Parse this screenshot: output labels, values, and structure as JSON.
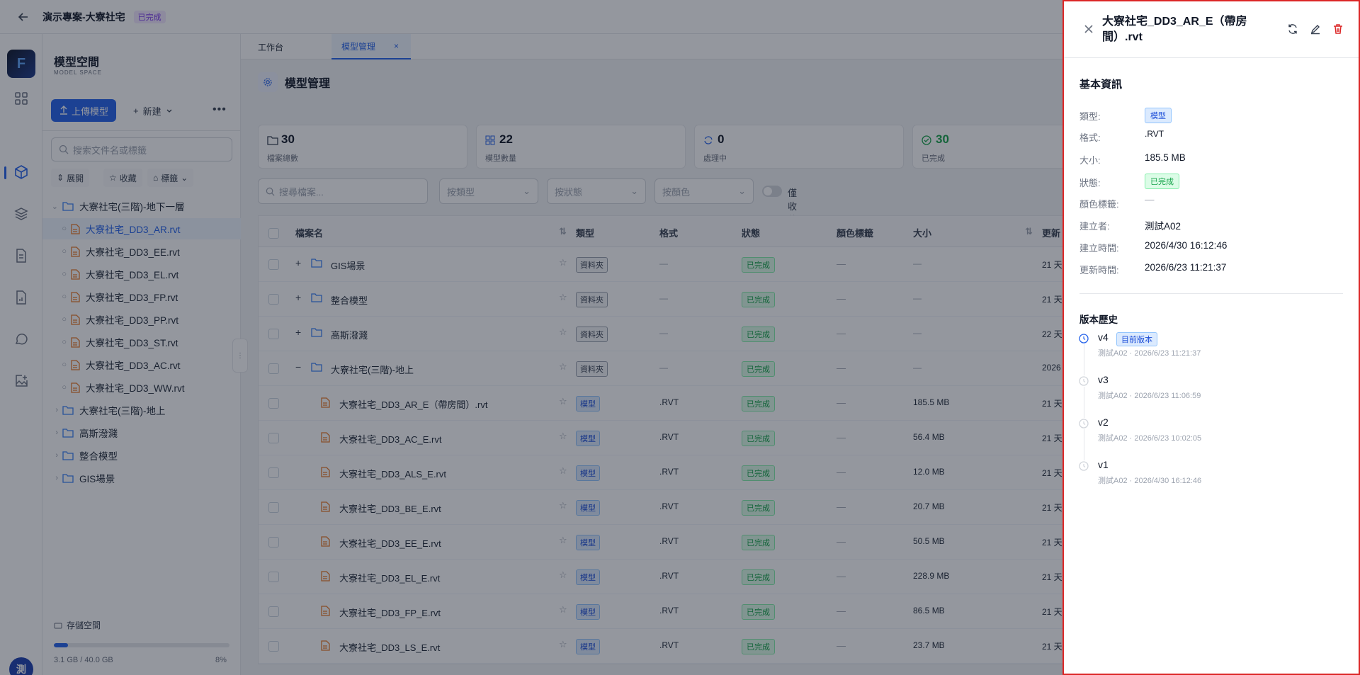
{
  "topbar": {
    "project_title": "演示專案-大寮社宅",
    "status_badge": "已完成"
  },
  "sidebar": {
    "title": "模型空間",
    "subtitle": "MODEL SPACE",
    "upload_label": "上傳模型",
    "new_label": "新建",
    "search_placeholder": "搜索文件名或標籤",
    "filters": {
      "expand": "展開",
      "favorite": "收藏",
      "tags": "標籤"
    },
    "tree": [
      {
        "label": "大寮社宅(三階)-地下一層",
        "kind": "folder-open",
        "depth": 0
      },
      {
        "label": "大寮社宅_DD3_AR.rvt",
        "kind": "file",
        "depth": 1,
        "active": true
      },
      {
        "label": "大寮社宅_DD3_EE.rvt",
        "kind": "file",
        "depth": 1
      },
      {
        "label": "大寮社宅_DD3_EL.rvt",
        "kind": "file",
        "depth": 1
      },
      {
        "label": "大寮社宅_DD3_FP.rvt",
        "kind": "file",
        "depth": 1
      },
      {
        "label": "大寮社宅_DD3_PP.rvt",
        "kind": "file",
        "depth": 1
      },
      {
        "label": "大寮社宅_DD3_ST.rvt",
        "kind": "file",
        "depth": 1
      },
      {
        "label": "大寮社宅_DD3_AC.rvt",
        "kind": "file",
        "depth": 1
      },
      {
        "label": "大寮社宅_DD3_WW.rvt",
        "kind": "file",
        "depth": 1
      },
      {
        "label": "大寮社宅(三階)-地上",
        "kind": "folder",
        "depth": 0
      },
      {
        "label": "高斯潑濺",
        "kind": "folder",
        "depth": 0
      },
      {
        "label": "整合模型",
        "kind": "folder",
        "depth": 0
      },
      {
        "label": "GIS場景",
        "kind": "folder",
        "depth": 0
      }
    ],
    "storage": {
      "label": "存儲空間",
      "used": "3.1 GB / 40.0 GB",
      "percent": "8%",
      "fraction": 0.08
    }
  },
  "tabs": [
    {
      "label": "工作台"
    },
    {
      "label": "模型管理",
      "active": true
    }
  ],
  "page": {
    "title": "模型管理"
  },
  "stats": [
    {
      "value": "30",
      "label": "檔案總數",
      "color": "#111827"
    },
    {
      "value": "22",
      "label": "模型數量",
      "color": "#111827"
    },
    {
      "value": "0",
      "label": "處理中",
      "color": "#111827"
    },
    {
      "value": "30",
      "label": "已完成",
      "color": "#16a34a"
    }
  ],
  "filters": {
    "search_placeholder": "搜尋檔案...",
    "type_placeholder": "按類型",
    "status_placeholder": "按狀態",
    "color_placeholder": "按顏色",
    "favorites_only": "僅收藏"
  },
  "table": {
    "columns": [
      "檔案名",
      "類型",
      "格式",
      "狀態",
      "顏色標籤",
      "大小",
      "更新"
    ],
    "rows": [
      {
        "name": "GIS場景",
        "kind": "folder",
        "toggle": "+",
        "type": "資料夾",
        "format": "—",
        "status": "已完成",
        "color_tag": "—",
        "size": "—",
        "updated": "21 天"
      },
      {
        "name": "整合模型",
        "kind": "folder",
        "toggle": "+",
        "type": "資料夾",
        "format": "—",
        "status": "已完成",
        "color_tag": "—",
        "size": "—",
        "updated": "21 天"
      },
      {
        "name": "高斯潑濺",
        "kind": "folder",
        "toggle": "+",
        "type": "資料夾",
        "format": "—",
        "status": "已完成",
        "color_tag": "—",
        "size": "—",
        "updated": "22 天"
      },
      {
        "name": "大寮社宅(三階)-地上",
        "kind": "folder",
        "toggle": "−",
        "type": "資料夾",
        "format": "—",
        "status": "已完成",
        "color_tag": "—",
        "size": "—",
        "updated": "2026"
      },
      {
        "name": "大寮社宅_DD3_AR_E（帶房間）.rvt",
        "kind": "file",
        "type": "模型",
        "format": ".RVT",
        "status": "已完成",
        "color_tag": "—",
        "size": "185.5 MB",
        "updated": "21 天"
      },
      {
        "name": "大寮社宅_DD3_AC_E.rvt",
        "kind": "file",
        "type": "模型",
        "format": ".RVT",
        "status": "已完成",
        "color_tag": "—",
        "size": "56.4 MB",
        "updated": "21 天"
      },
      {
        "name": "大寮社宅_DD3_ALS_E.rvt",
        "kind": "file",
        "type": "模型",
        "format": ".RVT",
        "status": "已完成",
        "color_tag": "—",
        "size": "12.0 MB",
        "updated": "21 天"
      },
      {
        "name": "大寮社宅_DD3_BE_E.rvt",
        "kind": "file",
        "type": "模型",
        "format": ".RVT",
        "status": "已完成",
        "color_tag": "—",
        "size": "20.7 MB",
        "updated": "21 天"
      },
      {
        "name": "大寮社宅_DD3_EE_E.rvt",
        "kind": "file",
        "type": "模型",
        "format": ".RVT",
        "status": "已完成",
        "color_tag": "—",
        "size": "50.5 MB",
        "updated": "21 天"
      },
      {
        "name": "大寮社宅_DD3_EL_E.rvt",
        "kind": "file",
        "type": "模型",
        "format": ".RVT",
        "status": "已完成",
        "color_tag": "—",
        "size": "228.9 MB",
        "updated": "21 天"
      },
      {
        "name": "大寮社宅_DD3_FP_E.rvt",
        "kind": "file",
        "type": "模型",
        "format": ".RVT",
        "status": "已完成",
        "color_tag": "—",
        "size": "86.5 MB",
        "updated": "21 天"
      },
      {
        "name": "大寮社宅_DD3_LS_E.rvt",
        "kind": "file",
        "type": "模型",
        "format": ".RVT",
        "status": "已完成",
        "color_tag": "—",
        "size": "23.7 MB",
        "updated": "21 天"
      }
    ]
  },
  "drawer": {
    "title": "大寮社宅_DD3_AR_E（帶房間）.rvt",
    "basic_info_title": "基本資訊",
    "fields": {
      "type_label": "類型:",
      "type_value": "模型",
      "format_label": "格式:",
      "format_value": ".RVT",
      "size_label": "大小:",
      "size_value": "185.5 MB",
      "status_label": "狀態:",
      "status_value": "已完成",
      "color_label": "顏色標籤:",
      "color_value": "—",
      "creator_label": "建立者:",
      "creator_value": "測試A02",
      "created_label": "建立時間:",
      "created_value": "2026/4/30 16:12:46",
      "updated_label": "更新時間:",
      "updated_value": "2026/6/23 11:21:37"
    },
    "history_title": "版本歷史",
    "current_badge": "目前版本",
    "versions": [
      {
        "version": "v4",
        "meta": "測試A02 · 2026/6/23 11:21:37",
        "current": true
      },
      {
        "version": "v3",
        "meta": "測試A02 · 2026/6/23 11:06:59"
      },
      {
        "version": "v2",
        "meta": "測試A02 · 2026/6/23 10:02:05"
      },
      {
        "version": "v1",
        "meta": "測試A02 · 2026/4/30 16:12:46"
      }
    ]
  },
  "avatar": {
    "initial": "測"
  },
  "colors": {
    "accent": "#2563eb",
    "success": "#16a34a",
    "danger": "#dc2626",
    "file_icon": "#ea7a2a",
    "folder_icon": "#3b82f6"
  }
}
